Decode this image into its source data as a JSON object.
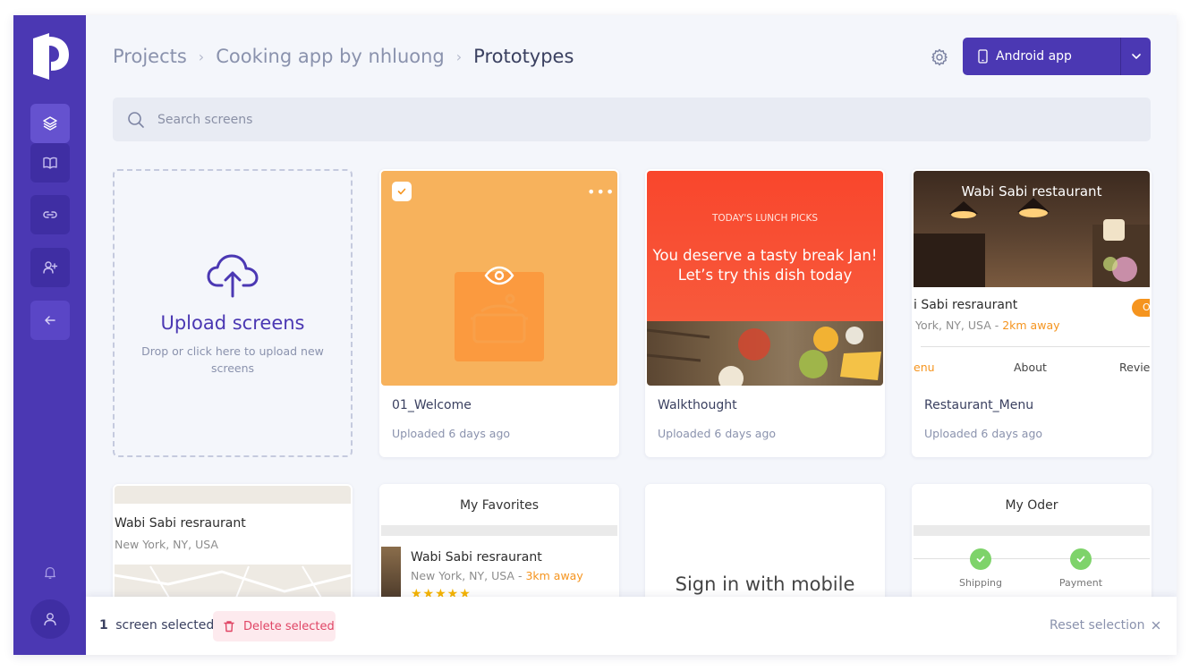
{
  "colors": {
    "brand": "#4b38b3",
    "danger": "#e04565",
    "accent_orange": "#f5941e"
  },
  "sidebar": {
    "items": [
      {
        "icon": "layers-icon",
        "active": true
      },
      {
        "icon": "book-icon"
      },
      {
        "icon": "link-icon"
      },
      {
        "icon": "add-user-icon"
      },
      {
        "icon": "arrow-left-icon"
      }
    ],
    "bottom": [
      "bell-icon",
      "user-icon"
    ]
  },
  "breadcrumb": {
    "root": "Projects",
    "project": "Cooking app by nhluong",
    "current": "Prototypes"
  },
  "header": {
    "platform_button": "Android app"
  },
  "search": {
    "placeholder": "Search screens",
    "value": ""
  },
  "upload": {
    "title": "Upload screens",
    "description": "Drop or click here to upload new screens"
  },
  "screens": [
    {
      "name": "01_Welcome",
      "uploaded": "Uploaded 6 days ago",
      "selected": true
    },
    {
      "name": "Walkthought",
      "uploaded": "Uploaded 6 days ago",
      "preview": {
        "small": "TODAY'S LUNCH PICKS",
        "line1": "You deserve a tasty break Jan!",
        "line2": "Let’s try this dish today"
      }
    },
    {
      "name": "Restaurant_Menu",
      "uploaded": "Uploaded 6 days ago",
      "preview": {
        "title": "Wabi Sabi restaurant",
        "name": "i Sabi resraurant",
        "location": "York, NY, USA - ",
        "distance": "2km away",
        "badge": "O",
        "tab1": "enu",
        "tab2": "About",
        "tab3": "Revie"
      }
    },
    {
      "preview": {
        "name": "Wabi Sabi resraurant",
        "location": "New York, NY, USA"
      }
    },
    {
      "preview": {
        "title": "My Favorites",
        "name": "Wabi Sabi resraurant",
        "location": "New York, NY, USA - ",
        "distance": "3km away",
        "stars": "★★★★★"
      }
    },
    {
      "preview": {
        "title": "Sign in with mobile"
      }
    },
    {
      "preview": {
        "title": "My Oder",
        "step1": "Shipping",
        "step2": "Payment"
      }
    }
  ],
  "selection": {
    "count": "1",
    "label": "screen selected",
    "delete": "Delete selected",
    "reset": "Reset selection"
  }
}
